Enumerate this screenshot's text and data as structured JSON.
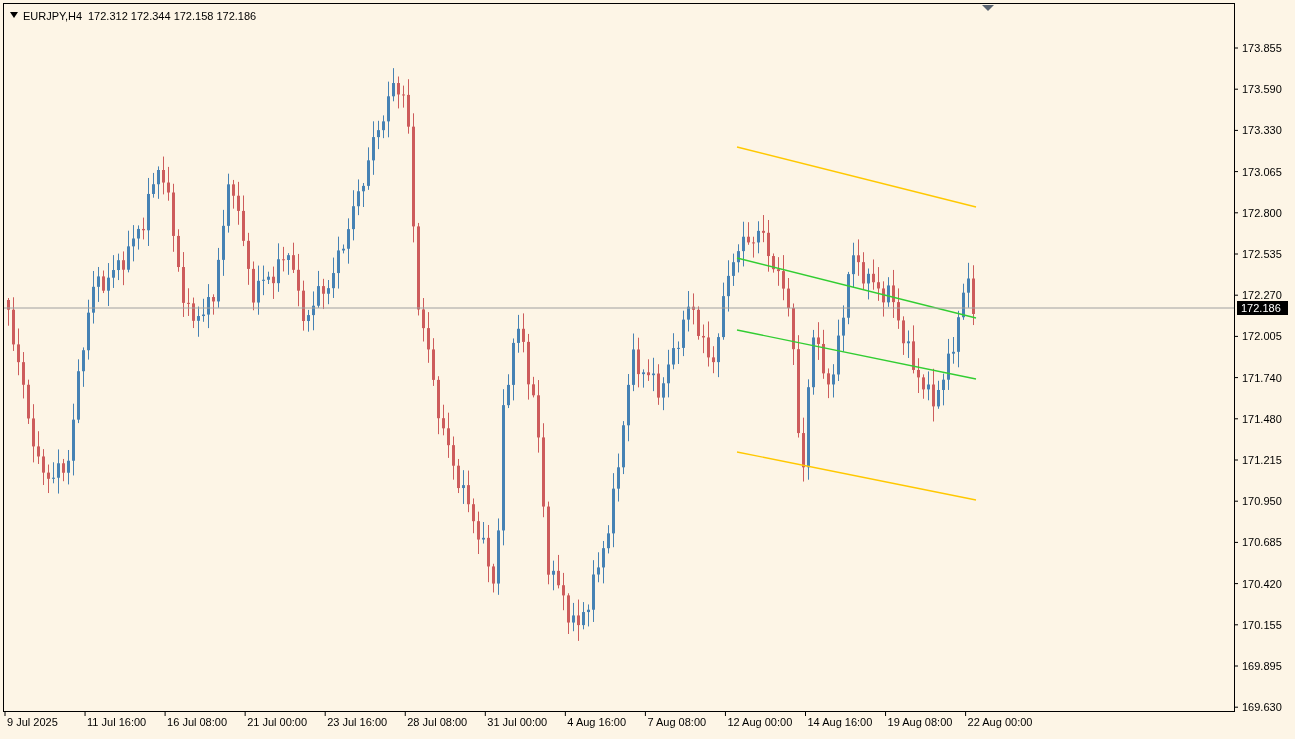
{
  "chart_header": {
    "symbol_timeframe": "EURJPY,H4",
    "quotes": "172.312 172.344 172.158 172.186"
  },
  "price_axis": {
    "labels": [
      "173.855",
      "173.590",
      "173.330",
      "173.065",
      "172.800",
      "172.535",
      "172.270",
      "172.005",
      "171.740",
      "171.480",
      "171.215",
      "170.950",
      "170.685",
      "170.420",
      "170.155",
      "169.895",
      "169.630"
    ],
    "current_price": "172.186"
  },
  "time_axis": {
    "labels": [
      "9 Jul 2025",
      "11 Jul 16:00",
      "16 Jul 08:00",
      "21 Jul 00:00",
      "23 Jul 16:00",
      "28 Jul 08:00",
      "31 Jul 00:00",
      "4 Aug 16:00",
      "7 Aug 08:00",
      "12 Aug 00:00",
      "14 Aug 16:00",
      "19 Aug 08:00",
      "22 Aug 00:00"
    ]
  }
}
